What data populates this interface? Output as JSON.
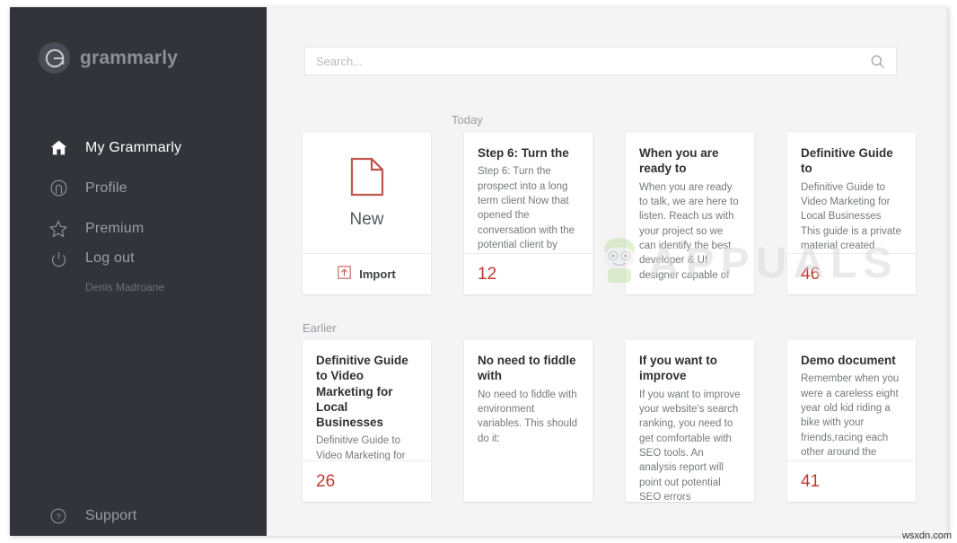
{
  "app": {
    "brand_name": "grammarly",
    "brand_mark_letter": "G"
  },
  "sidebar": {
    "items": [
      {
        "label": "My Grammarly",
        "icon": "home-icon",
        "active": true
      },
      {
        "label": "Profile",
        "icon": "user-circle-icon",
        "active": false
      },
      {
        "label": "Premium",
        "icon": "star-icon",
        "active": false
      },
      {
        "label": "Log out",
        "icon": "power-icon",
        "active": false,
        "sublabel": "Denis Madroane"
      }
    ],
    "support": {
      "label": "Support",
      "icon": "question-circle-icon"
    }
  },
  "search": {
    "placeholder": "Search...",
    "value": "",
    "icon": "search-icon"
  },
  "sections": [
    {
      "id": "today",
      "label": "Today"
    },
    {
      "id": "earlier",
      "label": "Earlier"
    }
  ],
  "new_card": {
    "new_label": "New",
    "import_label": "Import",
    "doc_icon": "new-document-icon",
    "import_icon": "upload-icon",
    "accent_color": "#c0392f"
  },
  "today_documents": [
    {
      "title": "Step 6: Turn the",
      "snippet": "Step 6: Turn the prospect into a long term client Now that opened the conversation with the potential client by",
      "score": "12"
    },
    {
      "title": "When you are ready to",
      "snippet": "When you are ready to talk, we are here to listen. Reach us with your project so we can identify the best developer & UI designer capable of",
      "score": ""
    },
    {
      "title": "Definitive Guide to",
      "snippet": "Definitive Guide to Video Marketing for Local Businesses This guide is a private material created",
      "score": "46"
    }
  ],
  "earlier_documents": [
    {
      "title": "Definitive Guide to Video Marketing for Local Businesses",
      "snippet": "Definitive Guide to Video Marketing for Local Businesses This",
      "score": "26"
    },
    {
      "title": "No need to fiddle with",
      "snippet": "No need to fiddle with environment variables. This should do it:",
      "score": ""
    },
    {
      "title": "If you want to improve",
      "snippet": "If you want to improve your website's search ranking, you need to get comfortable with SEO tools. An analysis report will point out potential SEO errors",
      "score": ""
    },
    {
      "title": "Demo document",
      "snippet": "Remember when you were a careless eight year old kid riding a bike with your friends,racing each other around the",
      "score": "41"
    }
  ],
  "watermarks": {
    "center": "APPUALS",
    "corner": "wsxdn.com"
  },
  "colors": {
    "sidebar_bg": "#32343a",
    "accent_red": "#c0392f",
    "page_bg": "#f4f4f5",
    "card_bg": "#ffffff"
  }
}
